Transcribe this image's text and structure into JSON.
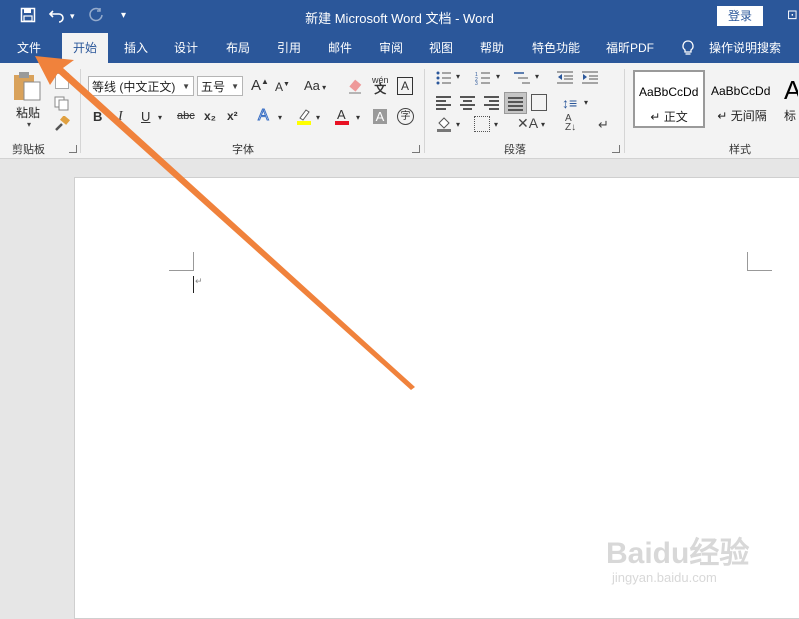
{
  "app": {
    "title": "新建 Microsoft Word 文档  -  Word",
    "login_label": "登录"
  },
  "quick_access": {
    "save_icon": "save-icon",
    "undo_icon": "undo-icon",
    "redo_icon": "redo-icon"
  },
  "tabs": [
    "文件",
    "开始",
    "插入",
    "设计",
    "布局",
    "引用",
    "邮件",
    "审阅",
    "视图",
    "帮助",
    "特色功能",
    "福昕PDF",
    "操作说明搜索"
  ],
  "active_tab": "开始",
  "ribbon": {
    "clipboard": {
      "paste_label": "粘贴",
      "group_label": "剪贴板"
    },
    "font": {
      "font_name": "等线 (中文正文)",
      "font_size": "五号",
      "group_label": "字体",
      "bold": "B",
      "italic": "I",
      "underline": "U",
      "strike": "abc",
      "sub": "x₂",
      "sup": "x²",
      "grow": "A",
      "shrink": "A",
      "case": "Aa",
      "phonetic": "wén",
      "border_char": "A",
      "shade_char": "A",
      "enclose": "字"
    },
    "paragraph": {
      "group_label": "段落"
    },
    "styles": {
      "group_label": "样式",
      "items": [
        {
          "sample": "AaBbCcDd",
          "name": "正文"
        },
        {
          "sample": "AaBbCcDd",
          "name": "无间隔"
        },
        {
          "sample": "A",
          "name": "标"
        }
      ]
    }
  },
  "watermark": {
    "main": "Baidu经验",
    "sub": "jingyan.baidu.com"
  },
  "colors": {
    "accent": "#2b579a",
    "arrow": "#f0823c",
    "highlight": "#ffff00",
    "font_color": "#e81123"
  }
}
